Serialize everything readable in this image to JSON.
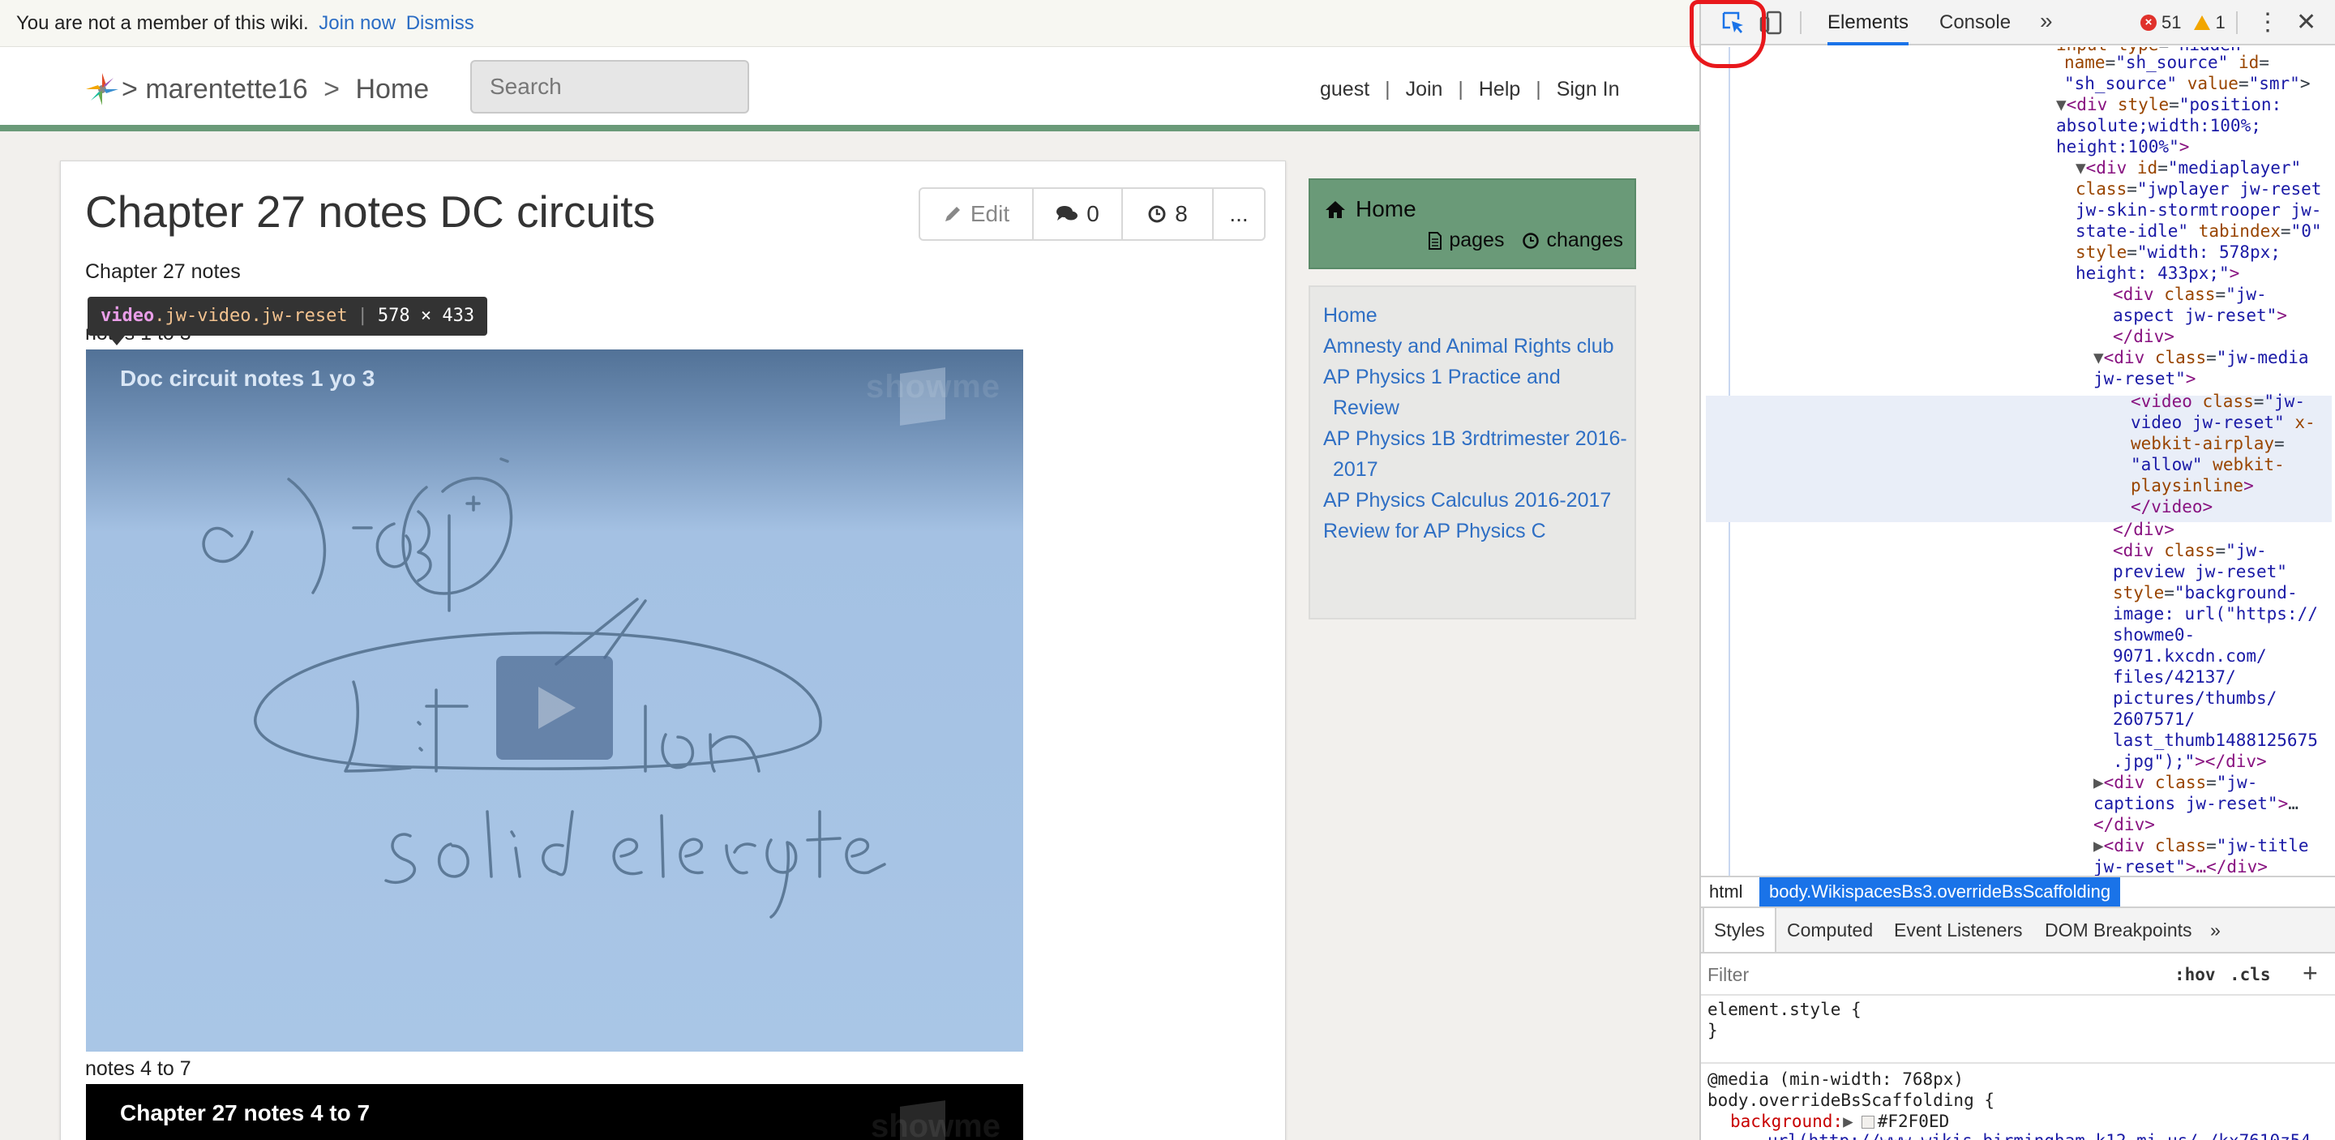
{
  "notice": {
    "text": "You are not a member of this wiki.",
    "join": "Join now",
    "dismiss": "Dismiss"
  },
  "header": {
    "wiki": "marentette16",
    "sep": ">",
    "page": "Home",
    "search_placeholder": "Search",
    "user_nav": [
      "guest",
      "Join",
      "Help",
      "Sign In"
    ],
    "user_sep": "|"
  },
  "page": {
    "title": "Chapter 27 notes DC circuits",
    "actions": {
      "edit": "Edit",
      "comments": "0",
      "history": "8",
      "more": "..."
    },
    "intro": "Chapter 27 notes",
    "notes_1_label": "notes 1 to 3",
    "notes_2_label": "notes 4 to 7",
    "tooltip": {
      "tag": "video",
      "classes": ".jw-video.jw-reset",
      "size": "578 × 433"
    },
    "video1": {
      "title": "Doc circuit notes 1 yo 3",
      "watermark": "showme"
    },
    "video2": {
      "title": "Chapter 27 notes 4 to 7",
      "watermark": "showme"
    }
  },
  "sidebar": {
    "home": "Home",
    "pages": "pages",
    "changes": "changes",
    "nav": [
      "Home",
      "Amnesty and Animal Rights club",
      "AP Physics 1 Practice and Review",
      "AP Physics 1B 3rdtrimester 2016-2017",
      "AP Physics Calculus 2016-2017",
      "Review for AP Physics C"
    ]
  },
  "devtools": {
    "tabs": [
      "Elements",
      "Console"
    ],
    "more_tabs": "»",
    "errors": "51",
    "warnings": "1",
    "menu": "⋮",
    "close": "✕",
    "breadcrumbs": [
      "html",
      "body.WikispacesBs3.overrideBsScaffolding"
    ],
    "style_tabs": [
      "Styles",
      "Computed",
      "Event Listeners",
      "DOM Breakpoints"
    ],
    "filter_placeholder": "Filter",
    "hov": ":hov",
    "cls": ".cls",
    "plus": "+",
    "element_style": "element.style {",
    "close_brace": "}",
    "media": "@media (min-width: 768px)",
    "selector": "body.overrideBsScaffolding {",
    "prop": "background:",
    "swatch_value": "#F2F0ED",
    "url_line": "url(http://www.wikis.birmingham.k12.mi.us/_/kx7610z54"
  },
  "colors": {
    "accent": "#6a9a78",
    "link": "#2f6fc4",
    "devtools_blue": "#1a73e8",
    "highlight": "#e8181c"
  }
}
